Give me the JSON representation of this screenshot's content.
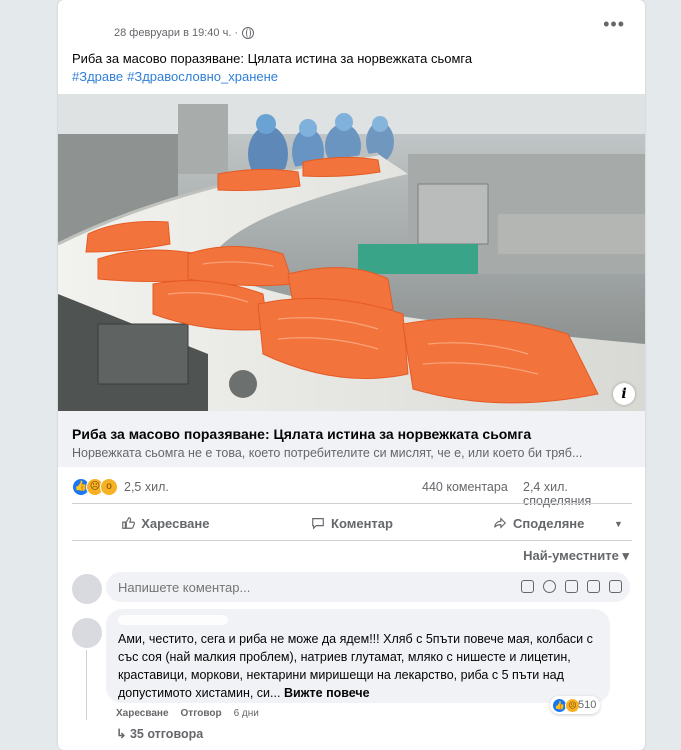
{
  "post": {
    "timestamp": "28 февруари в 19:40 ч. ·",
    "title": "Риба за масово поразяване: Цялата истина за норвежката сьомга",
    "hashtags": [
      "#Здраве",
      "#Здравословно_хранене"
    ],
    "more_icon": "more-dots-icon",
    "privacy_icon": "globe-icon"
  },
  "link_preview": {
    "title": "Риба за масово поразяване: Цялата истина за норвежката сьомга",
    "description": "Норвежката сьомга не е това, което потребителите си мислят, че е, или което би тряб...",
    "info_icon": "info-icon"
  },
  "stats": {
    "reactions": "2,5 хил.",
    "reaction_icons": [
      "like-icon",
      "sad-icon",
      "wow-icon"
    ],
    "comments": "440 коментара",
    "shares": "2,4 хил. споделяния"
  },
  "actions": {
    "like": "Харесване",
    "comment": "Коментар",
    "share": "Споделяне"
  },
  "comments": {
    "sort_label": "Най-уместните ▾",
    "input_placeholder": "Напишете коментар...",
    "items": [
      {
        "text": "Ами, честито, сега и риба не може да ядем!!! Хляб с 5пъти повече мая, колбаси с със соя (най малкия проблем), натриев глутамат, мляко с нишесте и лицетин, краставици, моркови, нектарини миришещи на лекарство, риба с 5 пъти над допустимото хистамин, си...",
        "see_more": "Вижте повече",
        "reaction_count": "510",
        "like_label": "Харесване",
        "reply_label": "Отговор",
        "age": "6 дни",
        "replies_label": "↳ 35 отговора"
      }
    ]
  },
  "colors": {
    "link": "#2f7fd8",
    "like_blue": "#1877f2",
    "secondary_text": "#65676b",
    "bubble_bg": "#f0f2f5"
  }
}
